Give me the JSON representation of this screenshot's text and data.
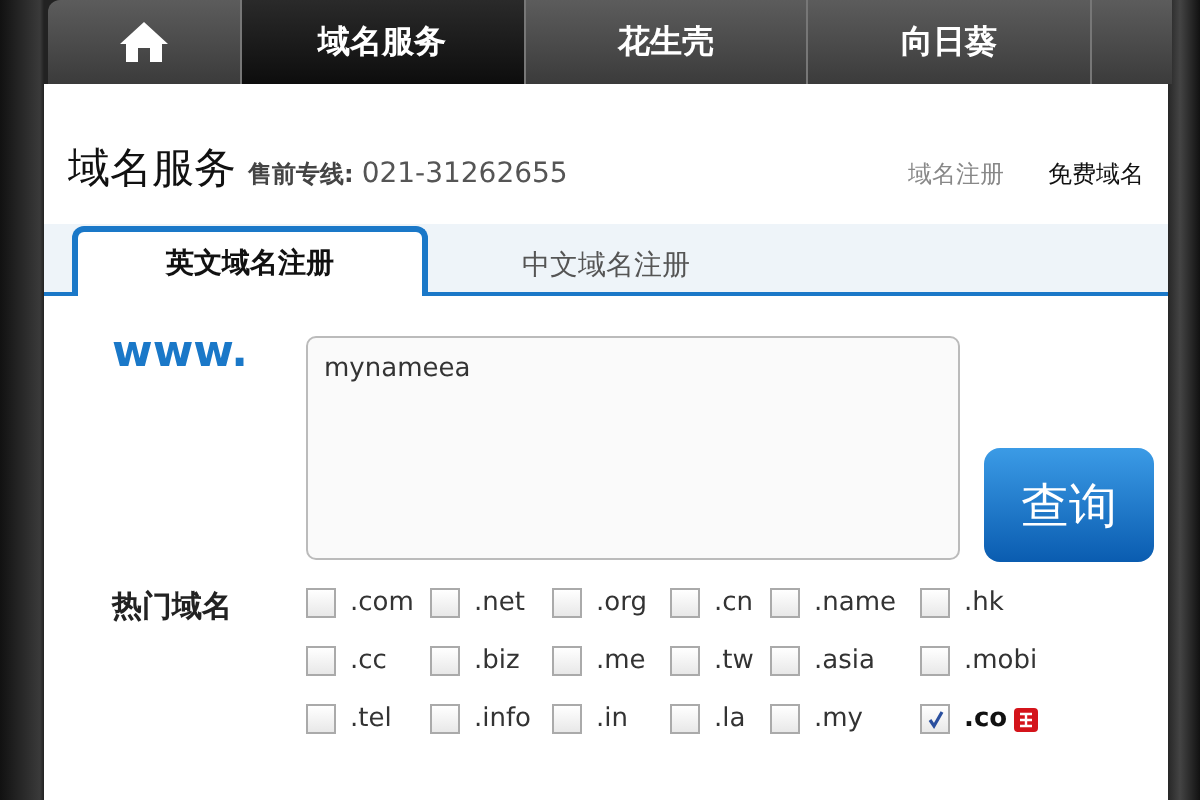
{
  "nav": {
    "tabs": [
      {
        "kind": "home",
        "selected": false
      },
      {
        "label": "域名服务",
        "selected": true
      },
      {
        "label": "花生壳",
        "selected": false
      },
      {
        "label": "向日葵",
        "selected": false
      },
      {
        "kind": "blank",
        "selected": false
      }
    ]
  },
  "header": {
    "title": "域名服务",
    "hotline_label": "售前专线:",
    "hotline": "021-31262655",
    "links": [
      {
        "label": "域名注册",
        "selected": false
      },
      {
        "label": "免费域名",
        "selected": true
      }
    ]
  },
  "tabs": [
    {
      "label": "英文域名注册",
      "selected": true
    },
    {
      "label": "中文域名注册",
      "selected": false
    }
  ],
  "form": {
    "prefix": "www.",
    "value": "mynameea",
    "button": "查询"
  },
  "popular": {
    "label": "热门域名",
    "items": [
      {
        "label": ".com",
        "checked": false,
        "hot": false
      },
      {
        "label": ".net",
        "checked": false,
        "hot": false
      },
      {
        "label": ".org",
        "checked": false,
        "hot": false
      },
      {
        "label": ".cn",
        "checked": false,
        "hot": false
      },
      {
        "label": ".name",
        "checked": false,
        "hot": false
      },
      {
        "label": ".hk",
        "checked": false,
        "hot": false
      },
      {
        "label": ".cc",
        "checked": false,
        "hot": false
      },
      {
        "label": ".biz",
        "checked": false,
        "hot": false
      },
      {
        "label": ".me",
        "checked": false,
        "hot": false
      },
      {
        "label": ".tw",
        "checked": false,
        "hot": false
      },
      {
        "label": ".asia",
        "checked": false,
        "hot": false
      },
      {
        "label": ".mobi",
        "checked": false,
        "hot": false
      },
      {
        "label": ".tel",
        "checked": false,
        "hot": false
      },
      {
        "label": ".info",
        "checked": false,
        "hot": false
      },
      {
        "label": ".in",
        "checked": false,
        "hot": false
      },
      {
        "label": ".la",
        "checked": false,
        "hot": false
      },
      {
        "label": ".my",
        "checked": false,
        "hot": false
      },
      {
        "label": ".co",
        "checked": true,
        "hot": true
      }
    ]
  }
}
